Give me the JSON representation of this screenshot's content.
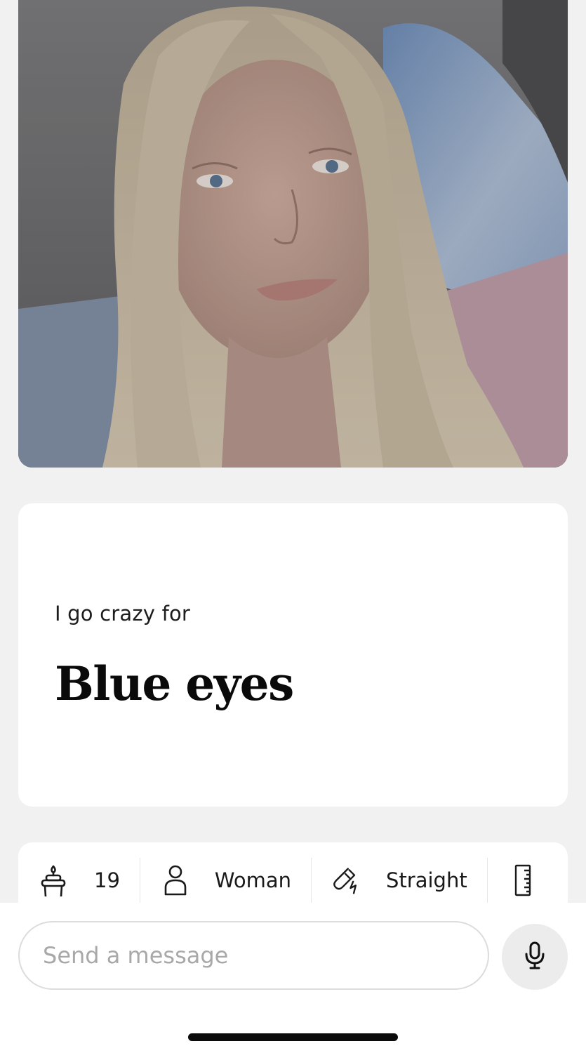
{
  "profile": {
    "photo_description_icon": "profile-photo",
    "prompt": {
      "question": "I go crazy for",
      "answer": "Blue eyes"
    },
    "vitals": [
      {
        "icon": "birthday-cake-icon",
        "label": "19"
      },
      {
        "icon": "person-icon",
        "label": "Woman"
      },
      {
        "icon": "magnet-icon",
        "label": "Straight"
      },
      {
        "icon": "ruler-icon",
        "label": ""
      }
    ]
  },
  "composer": {
    "placeholder": "Send a message",
    "mic_icon": "microphone-icon"
  },
  "colors": {
    "background": "#f1f1f1",
    "card": "#ffffff",
    "mic_bg": "#ececec"
  }
}
